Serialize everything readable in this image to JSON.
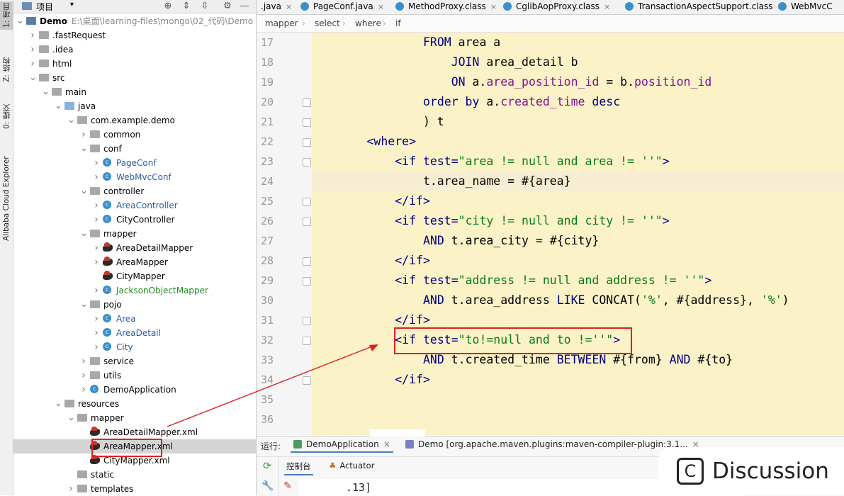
{
  "left_stripe": [
    {
      "label": "1: 项目",
      "active": true
    },
    {
      "label": "Z: 结构",
      "active": false
    },
    {
      "label": "0: 提交",
      "active": false
    },
    {
      "label": "Alibaba Cloud Explorer",
      "active": false
    }
  ],
  "project": {
    "title": "项目",
    "tree": [
      {
        "label": "Demo",
        "path": "E:\\桌面\\learning-files\\mongo\\02_代码\\Demo",
        "icon": "module-folder-icon",
        "expanded": true,
        "color": "normal"
      },
      {
        "label": ".fastRequest",
        "icon": "folder-icon",
        "expanded": false
      },
      {
        "label": ".idea",
        "icon": "folder-icon",
        "expanded": false
      },
      {
        "label": "html",
        "icon": "folder-icon",
        "expanded": false
      },
      {
        "label": "src",
        "icon": "folder-icon",
        "expanded": true
      },
      {
        "label": "main",
        "icon": "folder-icon",
        "expanded": true
      },
      {
        "label": "java",
        "icon": "source-folder-icon",
        "expanded": true
      },
      {
        "label": "com.example.demo",
        "icon": "package-icon",
        "expanded": true
      },
      {
        "label": "common",
        "icon": "package-icon",
        "expanded": false
      },
      {
        "label": "conf",
        "icon": "package-icon",
        "expanded": true
      },
      {
        "label": "PageConf",
        "icon": "class-icon",
        "expanded": false,
        "color": "blue"
      },
      {
        "label": "WebMvcConf",
        "icon": "class-icon",
        "expanded": false,
        "color": "blue"
      },
      {
        "label": "controller",
        "icon": "package-icon",
        "expanded": true
      },
      {
        "label": "AreaController",
        "icon": "class-icon",
        "expanded": false,
        "color": "blue"
      },
      {
        "label": "CityController",
        "icon": "class-icon",
        "expanded": false
      },
      {
        "label": "mapper",
        "icon": "package-icon",
        "expanded": true
      },
      {
        "label": "AreaDetailMapper",
        "icon": "mybatis-icon",
        "expanded": false
      },
      {
        "label": "AreaMapper",
        "icon": "mybatis-icon",
        "expanded": false
      },
      {
        "label": "CityMapper",
        "icon": "mybatis-icon",
        "expanded": null
      },
      {
        "label": "JacksonObjectMapper",
        "icon": "class-icon",
        "expanded": false,
        "color": "green"
      },
      {
        "label": "pojo",
        "icon": "package-icon",
        "expanded": true
      },
      {
        "label": "Area",
        "icon": "class-icon",
        "expanded": false,
        "color": "blue"
      },
      {
        "label": "AreaDetail",
        "icon": "class-icon",
        "expanded": false,
        "color": "blue"
      },
      {
        "label": "City",
        "icon": "class-icon",
        "expanded": false,
        "color": "blue"
      },
      {
        "label": "service",
        "icon": "package-icon",
        "expanded": false
      },
      {
        "label": "utils",
        "icon": "package-icon",
        "expanded": false
      },
      {
        "label": "DemoApplication",
        "icon": "spring-class-icon",
        "expanded": false
      },
      {
        "label": "resources",
        "icon": "resources-folder-icon",
        "expanded": true
      },
      {
        "label": "mapper",
        "icon": "folder-icon",
        "expanded": true
      },
      {
        "label": "AreaDetailMapper.xml",
        "icon": "mybatis-icon",
        "expanded": null
      },
      {
        "label": "AreaMapper.xml",
        "icon": "mybatis-icon",
        "expanded": null,
        "selected": true
      },
      {
        "label": "CityMapper.xml",
        "icon": "mybatis-icon",
        "expanded": null
      },
      {
        "label": "static",
        "icon": "folder-icon",
        "expanded": null
      },
      {
        "label": "templates",
        "icon": "folder-icon",
        "expanded": false
      }
    ]
  },
  "tabs": [
    {
      "label": ".java"
    },
    {
      "label": "PageConf.java"
    },
    {
      "label": "MethodProxy.class"
    },
    {
      "label": "CglibAopProxy.class"
    },
    {
      "label": "TransactionAspectSupport.class"
    },
    {
      "label": "WebMvcC"
    }
  ],
  "breadcrumb": [
    "mapper",
    "select",
    "where",
    "if"
  ],
  "editor": {
    "lines": [
      {
        "n": "17",
        "parts": [
          [
            "pl",
            "                "
          ],
          [
            "kw",
            "FROM"
          ],
          [
            "pl",
            " area a"
          ]
        ]
      },
      {
        "n": "18",
        "parts": [
          [
            "pl",
            "                    "
          ],
          [
            "kw",
            "JOIN"
          ],
          [
            "pl",
            " area_detail b"
          ]
        ]
      },
      {
        "n": "19",
        "parts": [
          [
            "pl",
            "                    "
          ],
          [
            "kw",
            "ON"
          ],
          [
            "pl",
            " a."
          ],
          [
            "fld",
            "area_position_id"
          ],
          [
            "pl",
            " = b."
          ],
          [
            "fld",
            "position_id"
          ]
        ]
      },
      {
        "n": "20",
        "parts": [
          [
            "pl",
            "                "
          ],
          [
            "kw",
            "order by"
          ],
          [
            "pl",
            " a."
          ],
          [
            "fld",
            "created_time"
          ],
          [
            "pl",
            " "
          ],
          [
            "kw",
            "desc"
          ]
        ]
      },
      {
        "n": "21",
        "parts": [
          [
            "pl",
            "                ) t"
          ]
        ]
      },
      {
        "n": "22",
        "parts": [
          [
            "pl",
            "        "
          ],
          [
            "tag",
            "<where>"
          ]
        ]
      },
      {
        "n": "23",
        "parts": [
          [
            "pl",
            "            "
          ],
          [
            "tag",
            "<if "
          ],
          [
            "tag",
            "test="
          ],
          [
            "str",
            "\"area != null and area != ''\""
          ],
          [
            "tag",
            ">"
          ]
        ]
      },
      {
        "n": "24",
        "parts": [
          [
            "pl",
            "                t.area_name = #{area}"
          ]
        ]
      },
      {
        "n": "25",
        "parts": [
          [
            "pl",
            "            "
          ],
          [
            "tag",
            "</if>"
          ]
        ]
      },
      {
        "n": "26",
        "parts": [
          [
            "pl",
            "            "
          ],
          [
            "tag",
            "<if "
          ],
          [
            "tag",
            "test="
          ],
          [
            "str",
            "\"city != null and city != ''\""
          ],
          [
            "tag",
            ">"
          ]
        ]
      },
      {
        "n": "27",
        "parts": [
          [
            "pl",
            "                "
          ],
          [
            "kw",
            "AND"
          ],
          [
            "pl",
            " t.area_city = #{city}"
          ]
        ]
      },
      {
        "n": "28",
        "parts": [
          [
            "pl",
            "            "
          ],
          [
            "tag",
            "</if>"
          ]
        ]
      },
      {
        "n": "29",
        "parts": [
          [
            "pl",
            "            "
          ],
          [
            "tag",
            "<if "
          ],
          [
            "tag",
            "test="
          ],
          [
            "str",
            "\"address != null and address != ''\""
          ],
          [
            "tag",
            ">"
          ]
        ]
      },
      {
        "n": "30",
        "parts": [
          [
            "pl",
            "                "
          ],
          [
            "kw",
            "AND"
          ],
          [
            "pl",
            " t.area_address "
          ],
          [
            "kw",
            "LIKE"
          ],
          [
            "pl",
            " CONCAT("
          ],
          [
            "str",
            "'%'"
          ],
          [
            "pl",
            ", #{address}, "
          ],
          [
            "str",
            "'%'"
          ],
          [
            "pl",
            ")"
          ]
        ]
      },
      {
        "n": "31",
        "parts": [
          [
            "pl",
            "            "
          ],
          [
            "tag",
            "</if>"
          ]
        ]
      },
      {
        "n": "32",
        "parts": [
          [
            "pl",
            "            "
          ],
          [
            "tag",
            "<if "
          ],
          [
            "tag",
            "test="
          ],
          [
            "str",
            "\"to!=null and to !=''\""
          ],
          [
            "tag",
            ">"
          ]
        ]
      },
      {
        "n": "33",
        "parts": [
          [
            "pl",
            "                "
          ],
          [
            "kw",
            "AND"
          ],
          [
            "pl",
            " t.created_time "
          ],
          [
            "kw",
            "BETWEEN"
          ],
          [
            "pl",
            " #{from} "
          ],
          [
            "kw",
            "AND"
          ],
          [
            "pl",
            " #{to}"
          ]
        ]
      },
      {
        "n": "34",
        "parts": [
          [
            "pl",
            "            "
          ],
          [
            "tag",
            "</if>"
          ]
        ]
      },
      {
        "n": "35",
        "parts": [
          [
            "pl",
            ""
          ]
        ]
      },
      {
        "n": "36",
        "parts": [
          [
            "pl",
            ""
          ]
        ]
      }
    ],
    "current_line": "24"
  },
  "run": {
    "label": "运行:",
    "tabs": [
      {
        "label": "DemoApplication",
        "active": true
      },
      {
        "label": "Demo [org.apache.maven.plugins:maven-compiler-plugin:3.1...",
        "active": false
      }
    ],
    "sub_tabs": [
      {
        "label": "控制台",
        "active": true
      },
      {
        "label": "Actuator",
        "active": false
      }
    ],
    "console": ".13]"
  },
  "watermark": "Discussion",
  "colors": {
    "editor_bg": "#fbf2c7",
    "annotation_red": "#e02020",
    "xml_tag": "#000080",
    "string": "#067d17",
    "field": "#871094"
  }
}
